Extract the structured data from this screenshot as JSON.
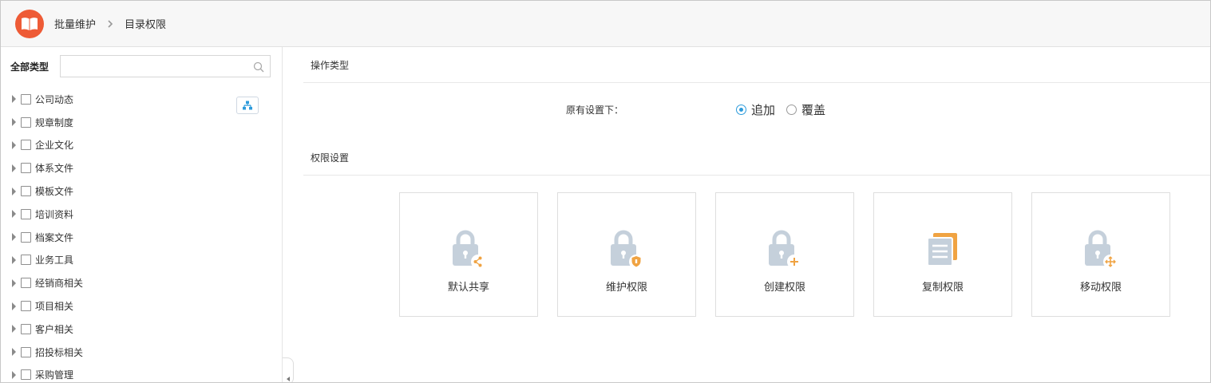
{
  "header": {
    "breadcrumb": [
      "批量维护",
      "目录权限"
    ]
  },
  "sidebar": {
    "title": "全部类型",
    "search": {
      "value": "",
      "placeholder": ""
    },
    "items": [
      {
        "label": "公司动态"
      },
      {
        "label": "规章制度"
      },
      {
        "label": "企业文化"
      },
      {
        "label": "体系文件"
      },
      {
        "label": "模板文件"
      },
      {
        "label": "培训资料"
      },
      {
        "label": "档案文件"
      },
      {
        "label": "业务工具"
      },
      {
        "label": "经销商相关"
      },
      {
        "label": "项目相关"
      },
      {
        "label": "客户相关"
      },
      {
        "label": "招投标相关"
      },
      {
        "label": "采购管理"
      }
    ]
  },
  "operation": {
    "section_title": "操作类型",
    "label": "原有设置下：",
    "options": [
      {
        "label": "追加",
        "selected": true
      },
      {
        "label": "覆盖",
        "selected": false
      }
    ]
  },
  "permissions": {
    "section_title": "权限设置",
    "cards": [
      {
        "label": "默认共享",
        "icon": "lock-share-icon"
      },
      {
        "label": "维护权限",
        "icon": "lock-shield-icon"
      },
      {
        "label": "创建权限",
        "icon": "lock-plus-icon"
      },
      {
        "label": "复制权限",
        "icon": "copy-document-icon"
      },
      {
        "label": "移动权限",
        "icon": "lock-move-icon"
      }
    ]
  },
  "colors": {
    "logo": "#ee5b36",
    "accent": "#2d9bdb",
    "lock_gray": "#c5d0db",
    "badge_orange": "#f0a342"
  }
}
